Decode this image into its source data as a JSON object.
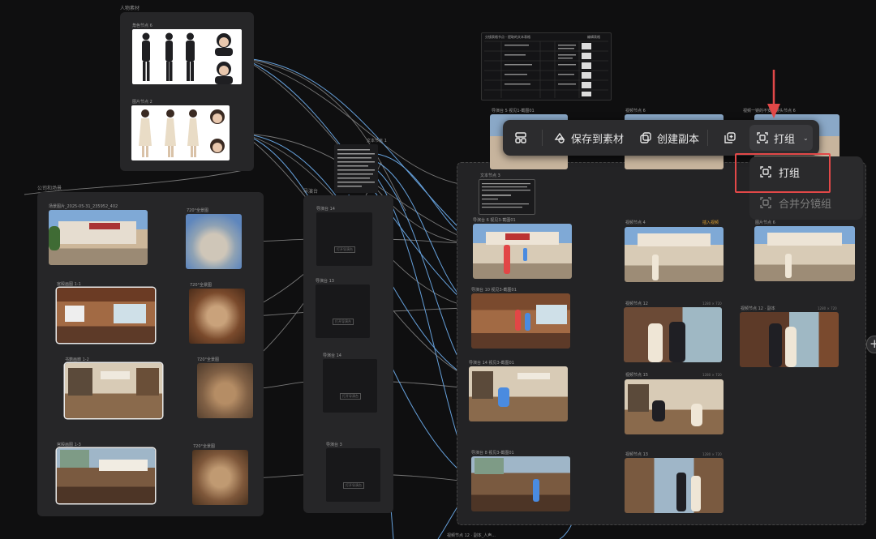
{
  "canvas": {
    "bg": "#0f0f10",
    "link_color": "#6aa8e6",
    "link_color_dim": "#8a8a8a",
    "highlight_color": "#e24848"
  },
  "groups": {
    "characters": {
      "title": "人物素材",
      "node1": "角色节点 6",
      "node2": "图片节点 2"
    },
    "scenes": {
      "title": "公司和场景",
      "rows": [
        {
          "label": "场景图片_2025-05-31_235952_402",
          "pano": "720°全景图"
        },
        {
          "label": "宫殿画图 1-1",
          "pano": "720°全景图"
        },
        {
          "label": "书籍画廊 1-2",
          "pano": "720°全景图"
        },
        {
          "label": "宫殿画图 1-3",
          "pano": "720°全景图"
        }
      ]
    },
    "director": {
      "title": "导演台",
      "nodes": [
        "导演台 14",
        "导演台 13",
        "导演台 14",
        "导演台 3"
      ],
      "btn": "打开导演台"
    },
    "text_node": {
      "title": "文本节点 1",
      "title2": "文本节点 3"
    }
  },
  "storyboard": {
    "col1": [
      "导演台 6 视见3-截图01",
      "导演台 10 视见3-截图01",
      "导演台 14 视见3-截图01",
      "导演台 8 视见3-截图01"
    ],
    "col2": [
      "视频节点 4",
      "视频节点 12",
      "视频节点 15",
      "视频节点 13"
    ],
    "col3": [
      "图片节点 6",
      "视频节点 12 · 副本"
    ],
    "top_labels": [
      "导演台 5 视见1-截图01",
      "视频节点 6",
      "视频一镜的不安排镜头节点 6"
    ],
    "meta": [
      "1280 × 720",
      "1280 × 720",
      "1280 × 720",
      "1280 × 720"
    ],
    "insert_video": "插入视频",
    "bottom_label": "视频节点 12 · 副本_人声..."
  },
  "toolbar": {
    "save_label": "保存到素材",
    "duplicate_label": "创建副本",
    "group_label": "打组"
  },
  "group_menu": {
    "group_label": "打组",
    "merge_label": "合并分镜组"
  },
  "table_node": {
    "title": "分镜表格节点 - 提取的文本表格",
    "header_right": "编辑表格"
  }
}
